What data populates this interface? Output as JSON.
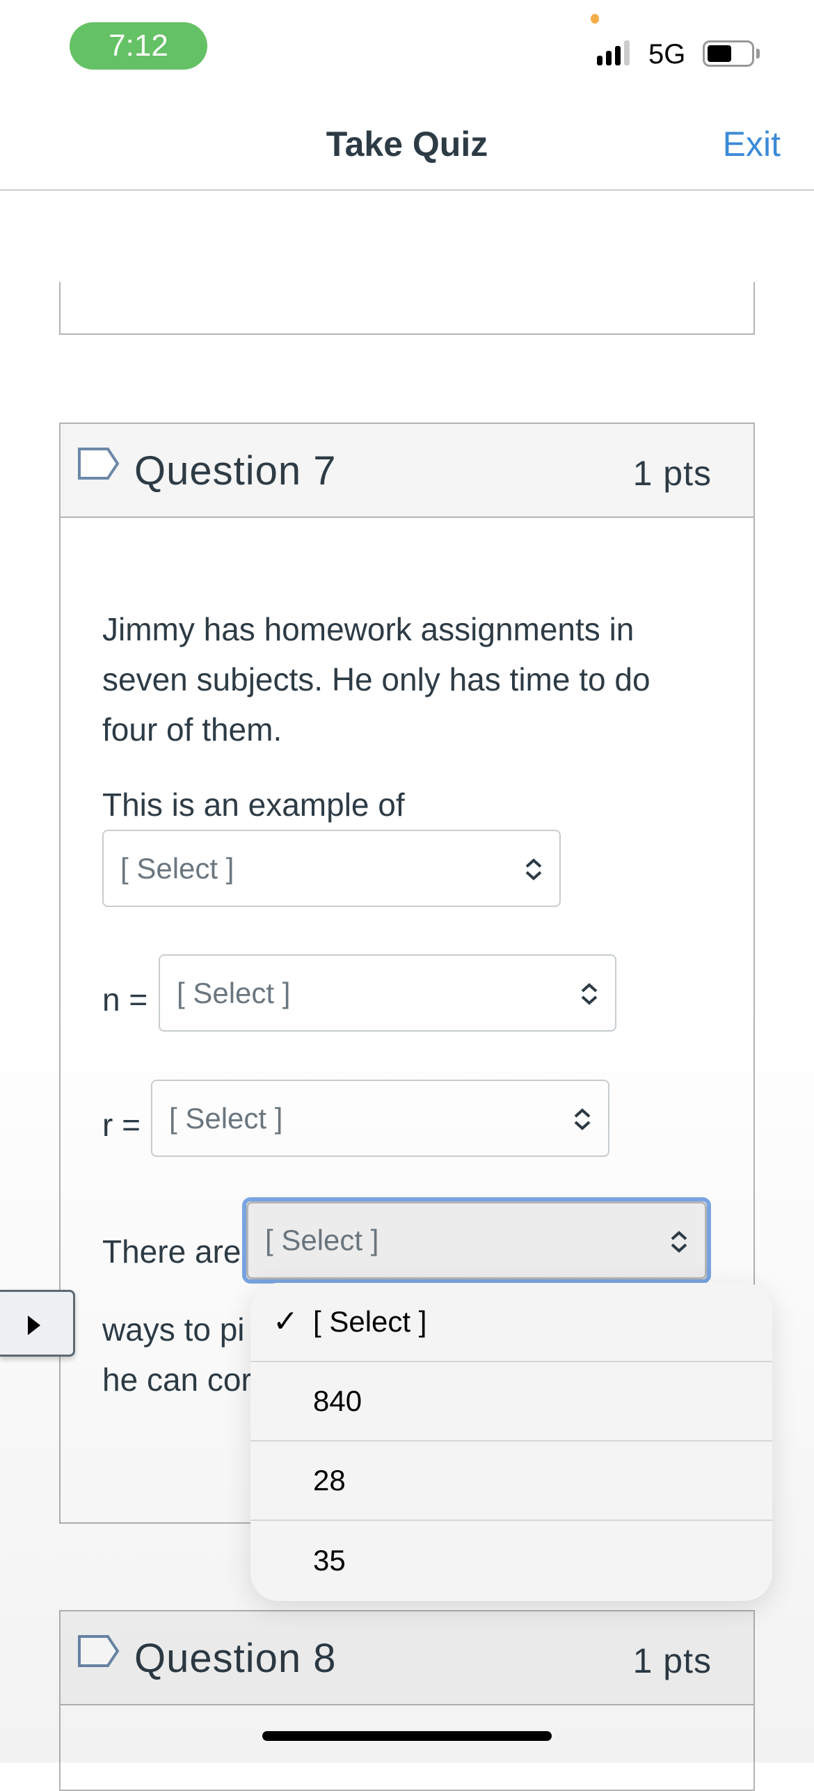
{
  "status_bar": {
    "time": "7:12",
    "network": "5G",
    "time_pill_color": "#64c165",
    "battery_level": "low"
  },
  "nav": {
    "title": "Take Quiz",
    "exit_label": "Exit",
    "accent": "#3b8ad8"
  },
  "question7": {
    "title": "Question 7",
    "points": "1 pts",
    "prompt_lines": [
      "Jimmy has homework assignments in",
      "seven subjects.  He only has time to do",
      "four of them."
    ],
    "example_label": "This is an example of",
    "select1": "[ Select ]",
    "n_label": "n =",
    "select2": "[ Select ]",
    "r_label": "r =",
    "select3": "[ Select ]",
    "there_are_label": "There are",
    "select4": "[ Select ]",
    "ways_line": "ways to pi",
    "can_line": "he can cor"
  },
  "dropdown": {
    "options": [
      {
        "label": "[ Select ]",
        "selected": true
      },
      {
        "label": "840"
      },
      {
        "label": "28"
      },
      {
        "label": "35"
      }
    ],
    "checkmark": "✓"
  },
  "question8": {
    "title": "Question 8",
    "points": "1 pts"
  }
}
